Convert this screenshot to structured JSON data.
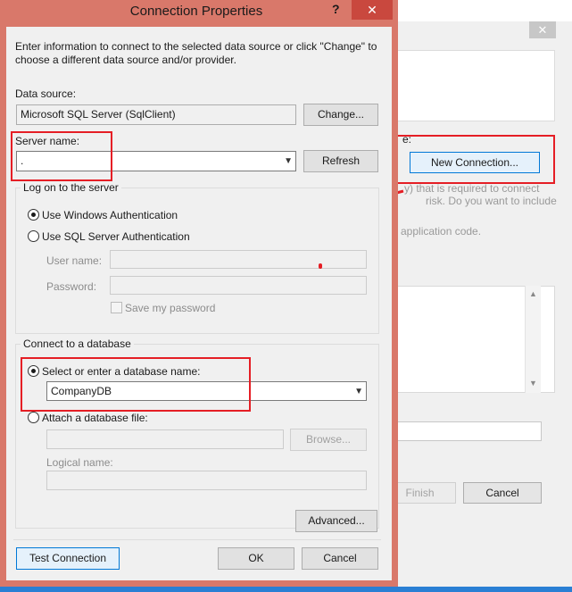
{
  "dialog": {
    "title": "Connection Properties",
    "help": "?",
    "close": "✕",
    "instructions": "Enter information to connect to the selected data source or click \"Change\" to choose a different data source and/or provider.",
    "data_source": {
      "label": "Data source:",
      "value": "Microsoft SQL Server (SqlClient)",
      "change_button": "Change..."
    },
    "server": {
      "label": "Server name:",
      "value": ".",
      "refresh_button": "Refresh"
    },
    "logon": {
      "title": "Log on to the server",
      "windows_auth": "Use Windows Authentication",
      "sql_auth": "Use SQL Server Authentication",
      "username_label": "User name:",
      "password_label": "Password:",
      "save_password": "Save my password"
    },
    "database": {
      "title": "Connect to a database",
      "select_option": "Select or enter a database name:",
      "database_value": "CompanyDB",
      "attach_option": "Attach a database file:",
      "browse_button": "Browse...",
      "logical_name_label": "Logical name:"
    },
    "advanced_button": "Advanced...",
    "test_button": "Test Connection",
    "ok_button": "OK",
    "cancel_button": "Cancel"
  },
  "background_wizard": {
    "close": "✕",
    "choose_suffix": "e:",
    "new_connection_button": "New Connection...",
    "warning_line1": "y) that is required to connect",
    "warning_line2": "risk. Do you want to include",
    "warning_line3": "application code.",
    "finish_button": "Finish",
    "cancel_button": "Cancel"
  },
  "colors": {
    "annotation_red": "#e51e25",
    "dialog_frame": "#d9786a",
    "close_red": "#c9483e"
  }
}
